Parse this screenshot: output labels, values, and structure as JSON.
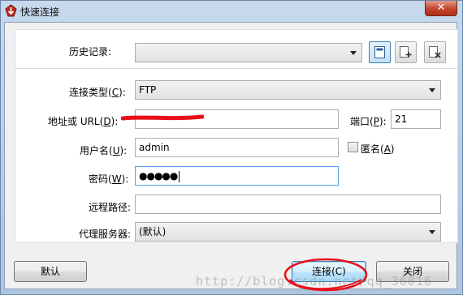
{
  "window": {
    "title": "快速连接",
    "close_label": "✕"
  },
  "history": {
    "label": "历史记录:",
    "value": ""
  },
  "connection_type": {
    "label": "连接类型(",
    "hotkey": "C",
    "label_end": "):",
    "value": "FTP"
  },
  "address": {
    "label": "地址或 URL(",
    "hotkey": "D",
    "label_end": "):",
    "value": "",
    "port_label": "端口(",
    "port_hotkey": "P",
    "port_label_end": "):",
    "port_value": "21"
  },
  "username": {
    "label": "用户名(",
    "hotkey": "U",
    "label_end": "):",
    "value": "admin",
    "anonymous_label": "匿名(",
    "anonymous_hotkey": "A",
    "anonymous_label_end": ")"
  },
  "password": {
    "label": "密码(",
    "hotkey": "W",
    "label_end": "):",
    "value": "●●●●●"
  },
  "remote_path": {
    "label": "远程路径:",
    "value": ""
  },
  "proxy": {
    "label": "代理服务器:",
    "value": "(默认)"
  },
  "buttons": {
    "default_label": "默认",
    "connect_label": "连接(C)",
    "close_label": "关闭"
  },
  "watermark": "http://blog.csdn.net/qq_36016"
}
